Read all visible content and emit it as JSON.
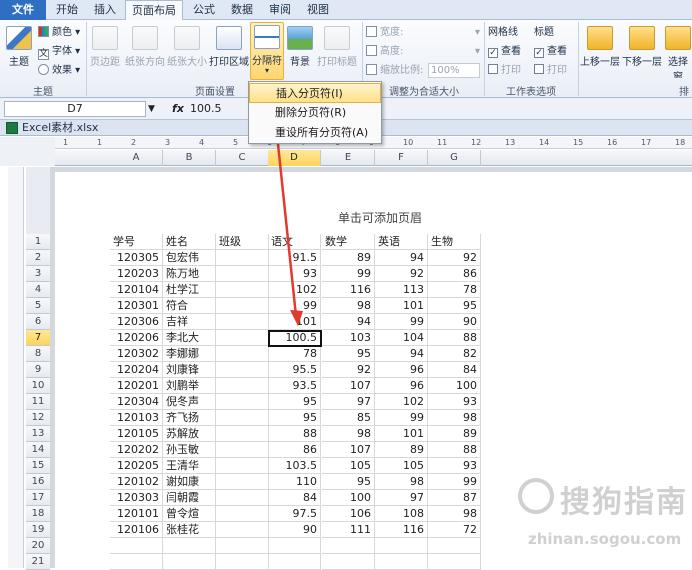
{
  "ribbon": {
    "tabs": [
      "文件",
      "开始",
      "插入",
      "页面布局",
      "公式",
      "数据",
      "审阅",
      "视图"
    ],
    "active_tab": "页面布局",
    "themes": {
      "theme": "主题",
      "colors": "颜色",
      "fonts": "字体",
      "effects": "效果",
      "group": "主题"
    },
    "page_setup": {
      "margins": "页边距",
      "orientation": "纸张方向",
      "size": "纸张大小",
      "print_area": "打印区域",
      "breaks": "分隔符",
      "background": "背景",
      "print_titles": "打印标题",
      "group": "页面设置"
    },
    "scale": {
      "width": "宽度:",
      "height": "高度:",
      "scale": "缩放比例:",
      "scale_value": "100%",
      "group": "调整为合适大小"
    },
    "sheet_options": {
      "gridlines": "网格线",
      "headings": "标题",
      "view": "查看",
      "print": "打印",
      "group": "工作表选项"
    },
    "arrange": {
      "bring_forward": "上移一层",
      "send_backward": "下移一层",
      "selection_pane": "选择窗",
      "group": "排"
    }
  },
  "breaks_menu": {
    "items": [
      "插入分页符(I)",
      "删除分页符(R)",
      "重设所有分页符(A)"
    ],
    "highlighted_index": 0
  },
  "formula_bar": {
    "name_box": "D7",
    "fx": "fx",
    "value": "100.5"
  },
  "workbook": {
    "title": "Excel素材.xlsx"
  },
  "sheet": {
    "header_hint": "单击可添加页眉",
    "columns": [
      "A",
      "B",
      "C",
      "D",
      "E",
      "F",
      "G"
    ],
    "selected_column": "D",
    "selected_row": 7,
    "ruler_marks": [
      "1",
      "1",
      "2",
      "3",
      "4",
      "5",
      "6",
      "7",
      "8",
      "9",
      "10",
      "11",
      "12",
      "13",
      "14",
      "15",
      "16",
      "17",
      "18"
    ],
    "headers": [
      "学号",
      "姓名",
      "班级",
      "语文",
      "数学",
      "英语",
      "生物"
    ],
    "rows": [
      [
        "120305",
        "包宏伟",
        "",
        "91.5",
        "89",
        "94",
        "92"
      ],
      [
        "120203",
        "陈万地",
        "",
        "93",
        "99",
        "92",
        "86"
      ],
      [
        "120104",
        "杜学江",
        "",
        "102",
        "116",
        "113",
        "78"
      ],
      [
        "120301",
        "符合",
        "",
        "99",
        "98",
        "101",
        "95"
      ],
      [
        "120306",
        "吉祥",
        "",
        "101",
        "94",
        "99",
        "90"
      ],
      [
        "120206",
        "李北大",
        "",
        "100.5",
        "103",
        "104",
        "88"
      ],
      [
        "120302",
        "李娜娜",
        "",
        "78",
        "95",
        "94",
        "82"
      ],
      [
        "120204",
        "刘康锋",
        "",
        "95.5",
        "92",
        "96",
        "84"
      ],
      [
        "120201",
        "刘鹏举",
        "",
        "93.5",
        "107",
        "96",
        "100"
      ],
      [
        "120304",
        "倪冬声",
        "",
        "95",
        "97",
        "102",
        "93"
      ],
      [
        "120103",
        "齐飞扬",
        "",
        "95",
        "85",
        "99",
        "98"
      ],
      [
        "120105",
        "苏解放",
        "",
        "88",
        "98",
        "101",
        "89"
      ],
      [
        "120202",
        "孙玉敏",
        "",
        "86",
        "107",
        "89",
        "88"
      ],
      [
        "120205",
        "王清华",
        "",
        "103.5",
        "105",
        "105",
        "93"
      ],
      [
        "120102",
        "谢如康",
        "",
        "110",
        "95",
        "98",
        "99"
      ],
      [
        "120303",
        "闫朝霞",
        "",
        "84",
        "100",
        "97",
        "87"
      ],
      [
        "120101",
        "曾令煊",
        "",
        "97.5",
        "106",
        "108",
        "98"
      ],
      [
        "120106",
        "张桂花",
        "",
        "90",
        "111",
        "116",
        "72"
      ]
    ],
    "row_numbers": [
      "1",
      "2",
      "3",
      "4",
      "5",
      "6",
      "7",
      "8",
      "9",
      "10",
      "11",
      "12",
      "13",
      "14",
      "15",
      "16",
      "17",
      "18",
      "19",
      "20",
      "21"
    ]
  },
  "watermark": {
    "text": "搜狗指南",
    "url": "zhinan.sogou.com"
  }
}
